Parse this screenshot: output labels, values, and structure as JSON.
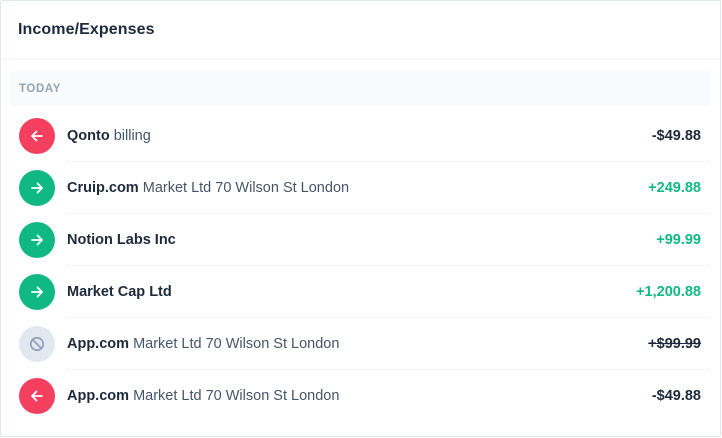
{
  "card": {
    "title": "Income/Expenses"
  },
  "section": {
    "label": "Today"
  },
  "colors": {
    "outgoing": "#f43f5e",
    "incoming": "#10b981",
    "cancelled": "#e2e8f0",
    "positive_amount": "#10b981"
  },
  "transactions": [
    {
      "type": "outgoing",
      "icon": "arrow-left-icon",
      "name": "Qonto",
      "detail": "billing",
      "amount": "-$49.88"
    },
    {
      "type": "incoming",
      "icon": "arrow-right-icon",
      "name": "Cruip.com",
      "detail": "Market Ltd 70 Wilson St London",
      "amount": "+249.88"
    },
    {
      "type": "incoming",
      "icon": "arrow-right-icon",
      "name": "Notion Labs Inc",
      "detail": "",
      "amount": "+99.99"
    },
    {
      "type": "incoming",
      "icon": "arrow-right-icon",
      "name": "Market Cap Ltd",
      "detail": "",
      "amount": "+1,200.88"
    },
    {
      "type": "cancelled",
      "icon": "cancel-icon",
      "name": "App.com",
      "detail": "Market Ltd 70 Wilson St London",
      "amount": "+$99.99"
    },
    {
      "type": "outgoing",
      "icon": "arrow-left-icon",
      "name": "App.com",
      "detail": "Market Ltd 70 Wilson St London",
      "amount": "-$49.88"
    }
  ]
}
